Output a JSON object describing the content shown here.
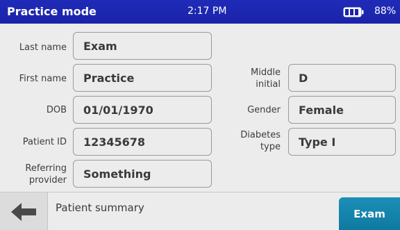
{
  "status_bar": {
    "title": "Practice mode",
    "time": "2:17 PM",
    "battery_percent": "88%",
    "battery_icon": "battery-icon"
  },
  "form": {
    "last_name": {
      "label": "Last name",
      "value": "Exam"
    },
    "first_name": {
      "label": "First name",
      "value": "Practice"
    },
    "middle_initial": {
      "label_line1": "Middle",
      "label_line2": "initial",
      "value": "D"
    },
    "dob": {
      "label": "DOB",
      "value": "01/01/1970"
    },
    "gender": {
      "label": "Gender",
      "value": "Female"
    },
    "patient_id": {
      "label": "Patient ID",
      "value": "12345678"
    },
    "diabetes_type": {
      "label_line1": "Diabetes",
      "label_line2": "type",
      "value": "Type I"
    },
    "referring_provider": {
      "label_line1": "Referring",
      "label_line2": "provider",
      "value": "Something"
    }
  },
  "bottom_bar": {
    "back_icon": "arrow-left-icon",
    "screen_label": "Patient summary",
    "exam_button": "Exam"
  },
  "colors": {
    "status_bar": "#1f2bb8",
    "exam_button": "#1b8fb8",
    "background": "#ececec"
  }
}
